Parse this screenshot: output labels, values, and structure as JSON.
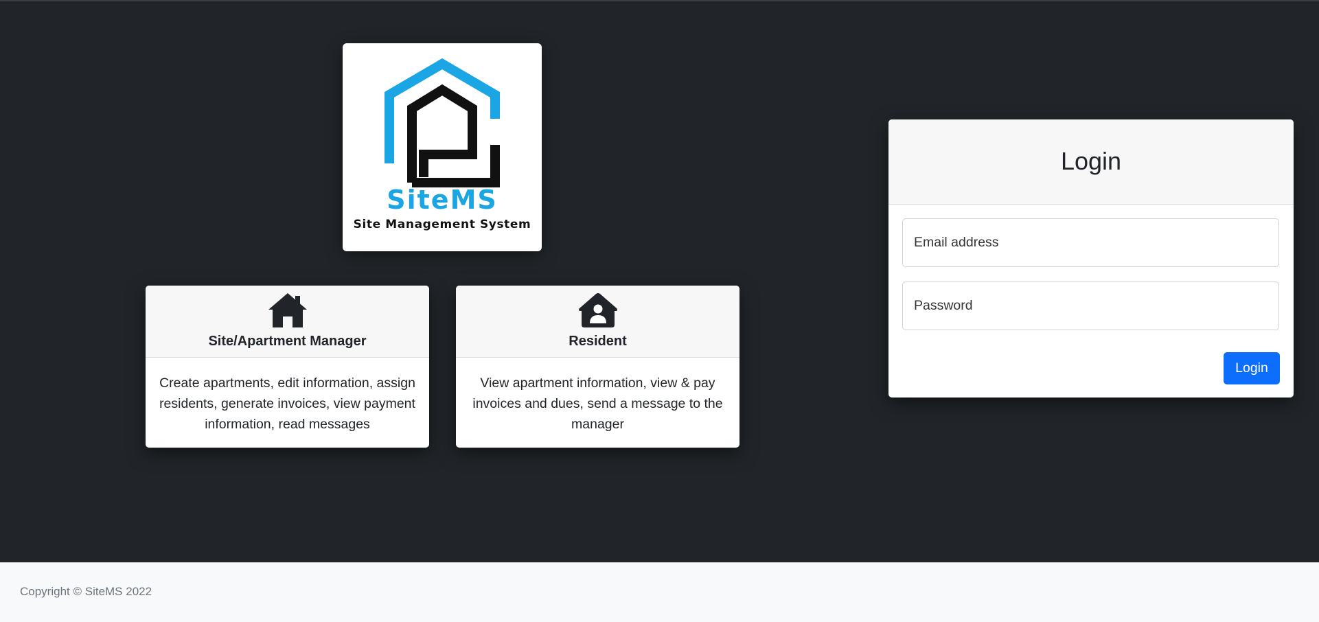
{
  "logo": {
    "name": "SiteMS",
    "tagline": "Site Management System",
    "colors": {
      "accent": "#1aa6e4",
      "dark": "#111111"
    }
  },
  "roles": [
    {
      "icon": "house-icon",
      "title": "Site/Apartment Manager",
      "description": "Create apartments, edit information, assign residents, generate invoices, view payment information, read messages"
    },
    {
      "icon": "house-user-icon",
      "title": "Resident",
      "description": "View apartment information, view & pay invoices and dues, send a message to the manager"
    }
  ],
  "login": {
    "title": "Login",
    "email_placeholder": "Email address",
    "password_placeholder": "Password",
    "button_label": "Login",
    "button_color": "#0d6efd"
  },
  "footer": {
    "copyright": "Copyright © SiteMS 2022"
  },
  "theme": {
    "background": "#212529",
    "footer_background": "#f8f9fa"
  }
}
